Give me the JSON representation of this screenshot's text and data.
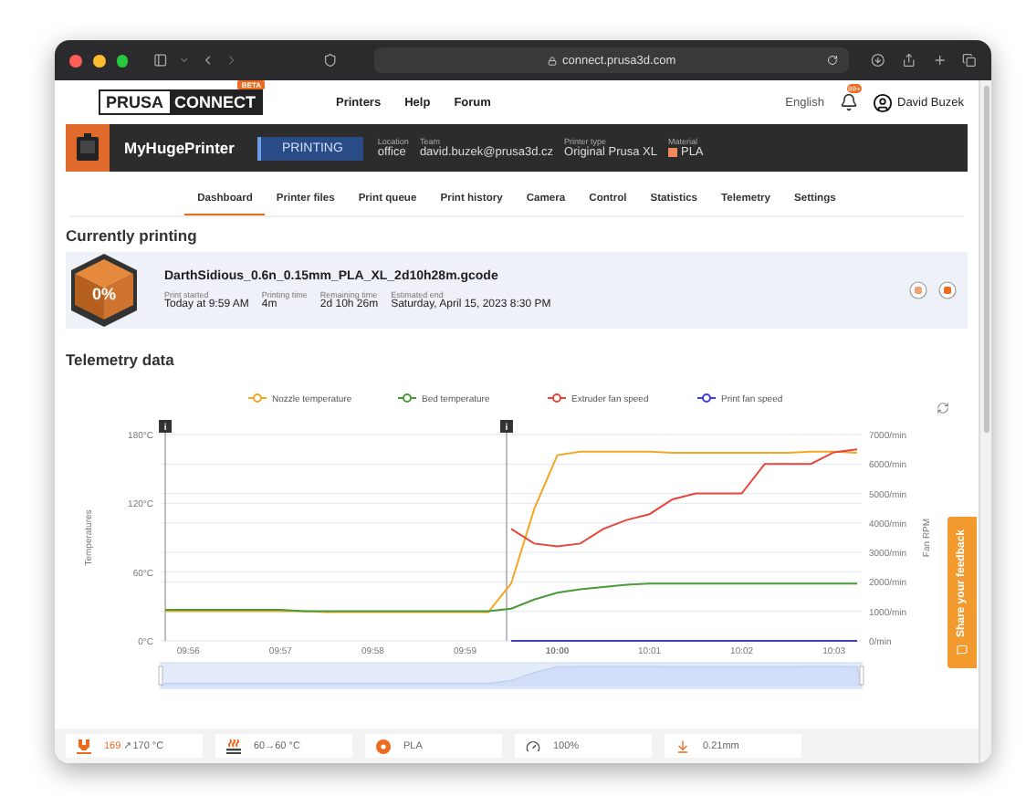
{
  "browser": {
    "url": "connect.prusa3d.com"
  },
  "header": {
    "logo": {
      "left": "PRUSA",
      "right": "CONNECT",
      "badge": "BETA"
    },
    "nav": [
      "Printers",
      "Help",
      "Forum"
    ],
    "language": "English",
    "notifications": "99+",
    "user": "David Buzek"
  },
  "printer": {
    "name": "MyHugePrinter",
    "status": "PRINTING",
    "fields": [
      {
        "label": "Location",
        "value": "office"
      },
      {
        "label": "Team",
        "value": "david.buzek@prusa3d.cz"
      },
      {
        "label": "Printer type",
        "value": "Original Prusa XL"
      },
      {
        "label": "Material",
        "value": "PLA",
        "color": "#f08a5d"
      }
    ]
  },
  "tabs": [
    {
      "label": "Dashboard",
      "selected": true
    },
    {
      "label": "Printer files",
      "selected": false
    },
    {
      "label": "Print queue",
      "selected": false
    },
    {
      "label": "Print history",
      "selected": false
    },
    {
      "label": "Camera",
      "selected": false
    },
    {
      "label": "Control",
      "selected": false
    },
    {
      "label": "Statistics",
      "selected": false
    },
    {
      "label": "Telemetry",
      "selected": false
    },
    {
      "label": "Settings",
      "selected": false
    }
  ],
  "current": {
    "title": "Currently printing",
    "progress": "0%",
    "file": "DarthSidious_0.6n_0.15mm_PLA_XL_2d10h28m.gcode",
    "fields": [
      {
        "label": "Print started",
        "value": "Today at 9:59 AM"
      },
      {
        "label": "Printing time",
        "value": "4m"
      },
      {
        "label": "Remaining time",
        "value": "2d 10h 26m"
      },
      {
        "label": "Estimated end",
        "value": "Saturday, April 15, 2023 8:30 PM"
      }
    ]
  },
  "telemetry": {
    "title": "Telemetry data",
    "chart_data": {
      "type": "line",
      "ylabel": "Temperatures",
      "y2label": "Fan RPM",
      "ylim": [
        0,
        180
      ],
      "y2lim": [
        0,
        7000
      ],
      "categories": [
        null,
        "09:56",
        null,
        null,
        null,
        "09:57",
        null,
        null,
        null,
        "09:58",
        null,
        null,
        null,
        "09:59",
        null,
        null,
        null,
        "10:00",
        null,
        null,
        null,
        "10:01",
        null,
        null,
        null,
        "10:02",
        null,
        null,
        null,
        "10:03",
        null
      ],
      "yticks": [
        {
          "value": 0,
          "label": "0°C"
        },
        {
          "value": 60,
          "label": "60°C"
        },
        {
          "value": 120,
          "label": "120°C"
        },
        {
          "value": 180,
          "label": "180°C"
        }
      ],
      "y2ticks": [
        {
          "value": 0,
          "label": "0/min"
        },
        {
          "value": 1000,
          "label": "1000/min"
        },
        {
          "value": 2000,
          "label": "2000/min"
        },
        {
          "value": 3000,
          "label": "3000/min"
        },
        {
          "value": 4000,
          "label": "4000/min"
        },
        {
          "value": 5000,
          "label": "5000/min"
        },
        {
          "value": 6000,
          "label": "6000/min"
        },
        {
          "value": 7000,
          "label": "7000/min"
        }
      ],
      "series": [
        {
          "name": "Nozzle temperature",
          "color": "#f5a623",
          "values": [
            26,
            26,
            26,
            26,
            26,
            26,
            26,
            25,
            25,
            25,
            25,
            25,
            25,
            25,
            25,
            50,
            115,
            162,
            165,
            165,
            165,
            165,
            164,
            164,
            164,
            164,
            164,
            164,
            165,
            165,
            164
          ]
        },
        {
          "name": "Bed temperature",
          "color": "#4a9a3a",
          "values": [
            27,
            27,
            27,
            27,
            27,
            27,
            26,
            26,
            26,
            26,
            26,
            26,
            26,
            26,
            26,
            28,
            36,
            42,
            45,
            47,
            49,
            50,
            50,
            50,
            50,
            50,
            50,
            50,
            50,
            50,
            50
          ]
        },
        {
          "name": "Extruder fan speed",
          "color": "#e8453c",
          "axis": "y2",
          "values": [
            null,
            null,
            null,
            null,
            null,
            null,
            null,
            null,
            null,
            null,
            null,
            null,
            null,
            null,
            null,
            3800,
            3300,
            3200,
            3300,
            3800,
            4100,
            4300,
            4800,
            5000,
            5000,
            5000,
            6000,
            6000,
            6000,
            6400,
            6500
          ]
        },
        {
          "name": "Print fan speed",
          "color": "#3a3ae8",
          "axis": "y2",
          "values": [
            null,
            null,
            null,
            null,
            null,
            null,
            null,
            null,
            null,
            null,
            null,
            null,
            null,
            null,
            null,
            0,
            0,
            0,
            0,
            0,
            0,
            0,
            0,
            0,
            0,
            0,
            0,
            0,
            0,
            0,
            0
          ]
        }
      ],
      "grid": true,
      "legend": "top"
    },
    "markers": [
      {
        "text": "i"
      },
      {
        "text": "i"
      }
    ]
  },
  "feedback": "Share your feedback",
  "status": [
    {
      "kind": "nozzle",
      "value": "169",
      "arrow": "↗",
      "target": "170 °C"
    },
    {
      "kind": "bed",
      "value": "60→60 °C"
    },
    {
      "kind": "material",
      "value": "PLA"
    },
    {
      "kind": "speed",
      "value": "100%"
    },
    {
      "kind": "height",
      "value": "0.21mm"
    }
  ]
}
